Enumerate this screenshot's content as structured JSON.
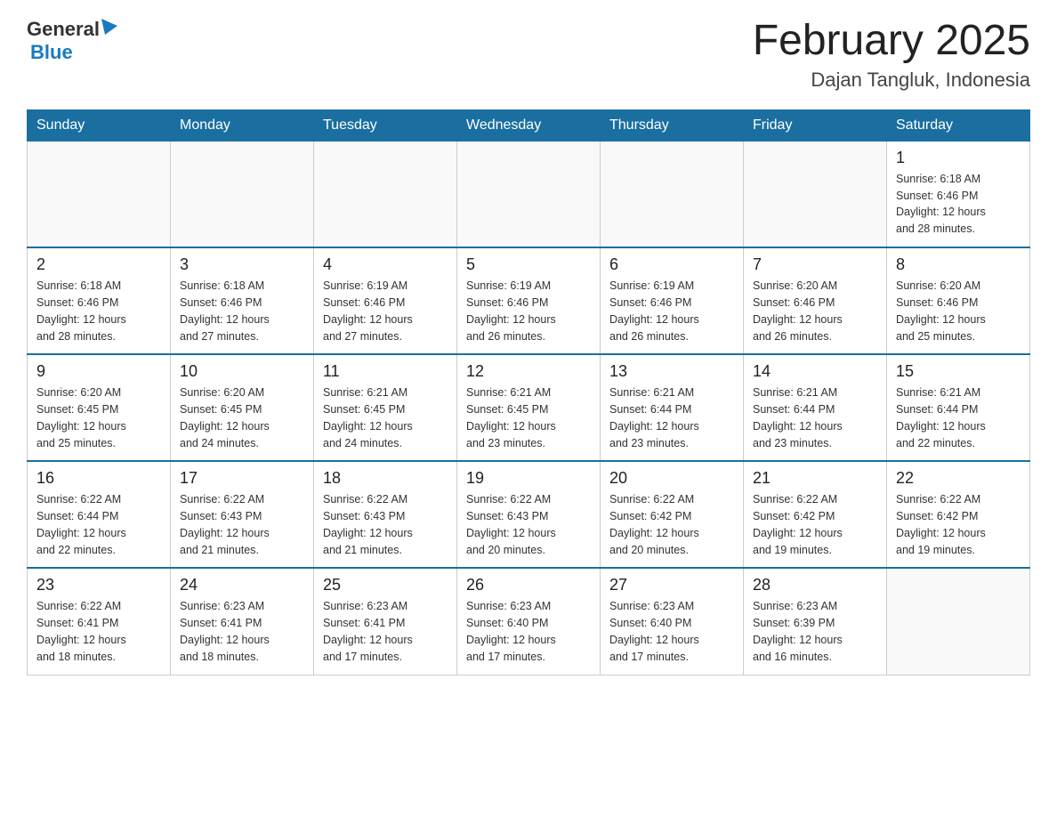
{
  "header": {
    "logo_general": "General",
    "logo_blue": "Blue",
    "month_title": "February 2025",
    "location": "Dajan Tangluk, Indonesia"
  },
  "weekdays": [
    "Sunday",
    "Monday",
    "Tuesday",
    "Wednesday",
    "Thursday",
    "Friday",
    "Saturday"
  ],
  "weeks": [
    [
      {
        "day": "",
        "info": ""
      },
      {
        "day": "",
        "info": ""
      },
      {
        "day": "",
        "info": ""
      },
      {
        "day": "",
        "info": ""
      },
      {
        "day": "",
        "info": ""
      },
      {
        "day": "",
        "info": ""
      },
      {
        "day": "1",
        "info": "Sunrise: 6:18 AM\nSunset: 6:46 PM\nDaylight: 12 hours\nand 28 minutes."
      }
    ],
    [
      {
        "day": "2",
        "info": "Sunrise: 6:18 AM\nSunset: 6:46 PM\nDaylight: 12 hours\nand 28 minutes."
      },
      {
        "day": "3",
        "info": "Sunrise: 6:18 AM\nSunset: 6:46 PM\nDaylight: 12 hours\nand 27 minutes."
      },
      {
        "day": "4",
        "info": "Sunrise: 6:19 AM\nSunset: 6:46 PM\nDaylight: 12 hours\nand 27 minutes."
      },
      {
        "day": "5",
        "info": "Sunrise: 6:19 AM\nSunset: 6:46 PM\nDaylight: 12 hours\nand 26 minutes."
      },
      {
        "day": "6",
        "info": "Sunrise: 6:19 AM\nSunset: 6:46 PM\nDaylight: 12 hours\nand 26 minutes."
      },
      {
        "day": "7",
        "info": "Sunrise: 6:20 AM\nSunset: 6:46 PM\nDaylight: 12 hours\nand 26 minutes."
      },
      {
        "day": "8",
        "info": "Sunrise: 6:20 AM\nSunset: 6:46 PM\nDaylight: 12 hours\nand 25 minutes."
      }
    ],
    [
      {
        "day": "9",
        "info": "Sunrise: 6:20 AM\nSunset: 6:45 PM\nDaylight: 12 hours\nand 25 minutes."
      },
      {
        "day": "10",
        "info": "Sunrise: 6:20 AM\nSunset: 6:45 PM\nDaylight: 12 hours\nand 24 minutes."
      },
      {
        "day": "11",
        "info": "Sunrise: 6:21 AM\nSunset: 6:45 PM\nDaylight: 12 hours\nand 24 minutes."
      },
      {
        "day": "12",
        "info": "Sunrise: 6:21 AM\nSunset: 6:45 PM\nDaylight: 12 hours\nand 23 minutes."
      },
      {
        "day": "13",
        "info": "Sunrise: 6:21 AM\nSunset: 6:44 PM\nDaylight: 12 hours\nand 23 minutes."
      },
      {
        "day": "14",
        "info": "Sunrise: 6:21 AM\nSunset: 6:44 PM\nDaylight: 12 hours\nand 23 minutes."
      },
      {
        "day": "15",
        "info": "Sunrise: 6:21 AM\nSunset: 6:44 PM\nDaylight: 12 hours\nand 22 minutes."
      }
    ],
    [
      {
        "day": "16",
        "info": "Sunrise: 6:22 AM\nSunset: 6:44 PM\nDaylight: 12 hours\nand 22 minutes."
      },
      {
        "day": "17",
        "info": "Sunrise: 6:22 AM\nSunset: 6:43 PM\nDaylight: 12 hours\nand 21 minutes."
      },
      {
        "day": "18",
        "info": "Sunrise: 6:22 AM\nSunset: 6:43 PM\nDaylight: 12 hours\nand 21 minutes."
      },
      {
        "day": "19",
        "info": "Sunrise: 6:22 AM\nSunset: 6:43 PM\nDaylight: 12 hours\nand 20 minutes."
      },
      {
        "day": "20",
        "info": "Sunrise: 6:22 AM\nSunset: 6:42 PM\nDaylight: 12 hours\nand 20 minutes."
      },
      {
        "day": "21",
        "info": "Sunrise: 6:22 AM\nSunset: 6:42 PM\nDaylight: 12 hours\nand 19 minutes."
      },
      {
        "day": "22",
        "info": "Sunrise: 6:22 AM\nSunset: 6:42 PM\nDaylight: 12 hours\nand 19 minutes."
      }
    ],
    [
      {
        "day": "23",
        "info": "Sunrise: 6:22 AM\nSunset: 6:41 PM\nDaylight: 12 hours\nand 18 minutes."
      },
      {
        "day": "24",
        "info": "Sunrise: 6:23 AM\nSunset: 6:41 PM\nDaylight: 12 hours\nand 18 minutes."
      },
      {
        "day": "25",
        "info": "Sunrise: 6:23 AM\nSunset: 6:41 PM\nDaylight: 12 hours\nand 17 minutes."
      },
      {
        "day": "26",
        "info": "Sunrise: 6:23 AM\nSunset: 6:40 PM\nDaylight: 12 hours\nand 17 minutes."
      },
      {
        "day": "27",
        "info": "Sunrise: 6:23 AM\nSunset: 6:40 PM\nDaylight: 12 hours\nand 17 minutes."
      },
      {
        "day": "28",
        "info": "Sunrise: 6:23 AM\nSunset: 6:39 PM\nDaylight: 12 hours\nand 16 minutes."
      },
      {
        "day": "",
        "info": ""
      }
    ]
  ]
}
